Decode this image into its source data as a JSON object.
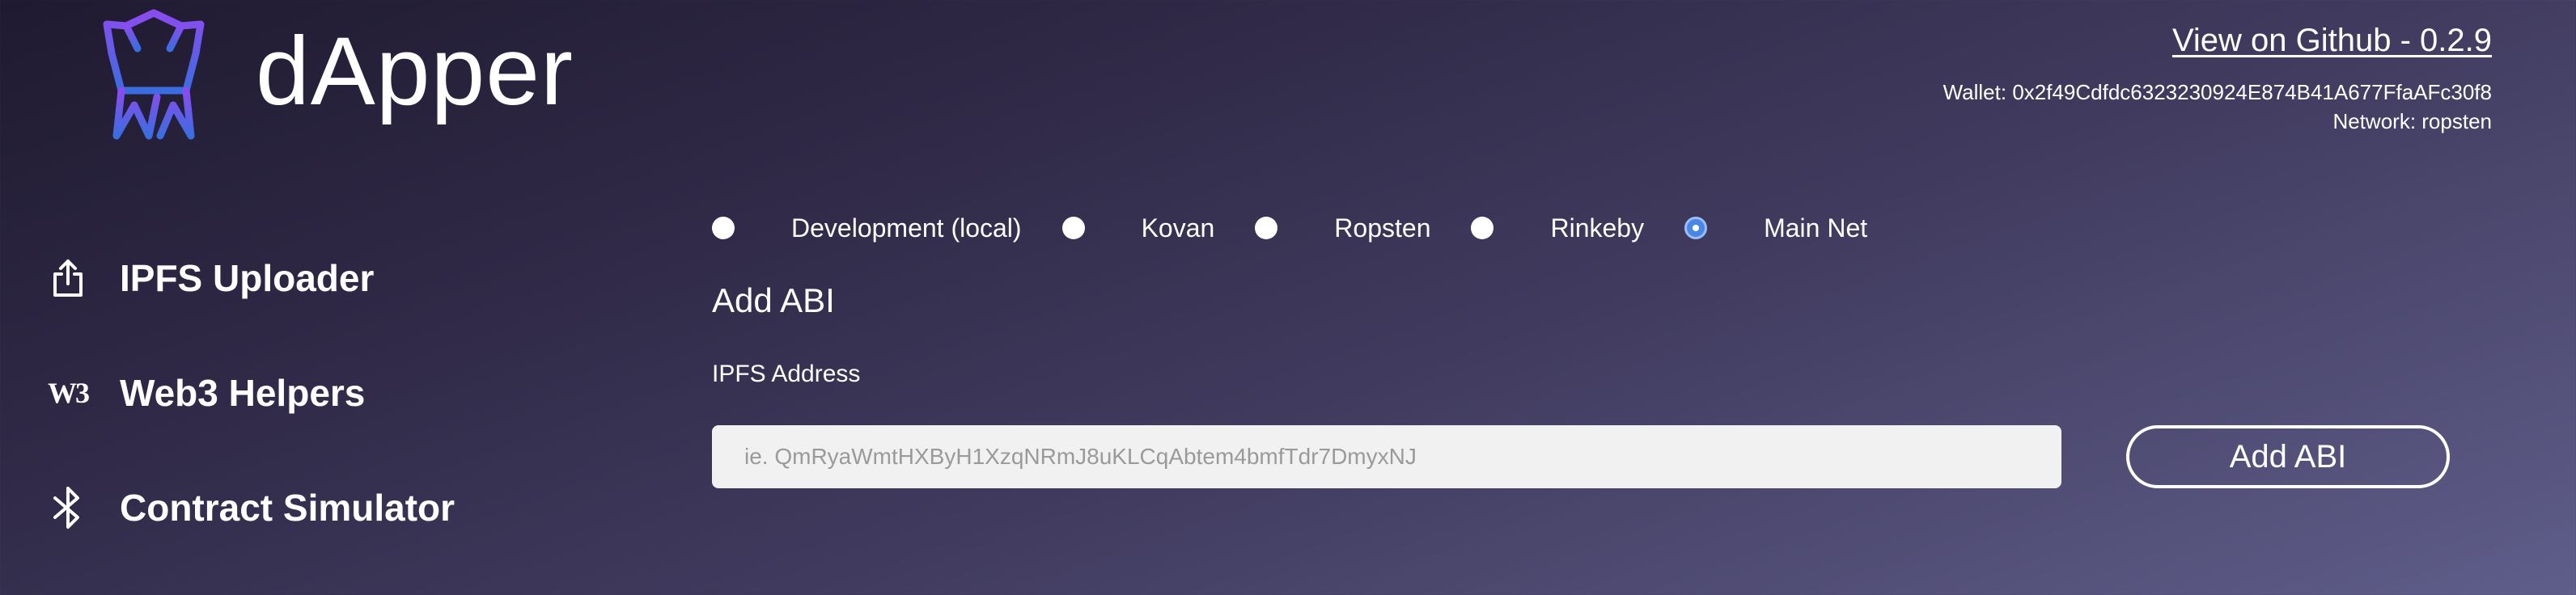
{
  "app": {
    "title": "dApper",
    "logo_icon": "dapper-robot-logo-icon"
  },
  "header": {
    "github_link": "View on Github - 0.2.9",
    "wallet_line": "Wallet: 0x2f49Cdfdc6323230924E874B41A677FfaAFc30f8",
    "network_line": "Network: ropsten"
  },
  "sidebar": {
    "items": [
      {
        "label": "IPFS Uploader",
        "icon": "upload-icon"
      },
      {
        "label": "Web3 Helpers",
        "icon": "w3-icon",
        "icon_text": "W3"
      },
      {
        "label": "Contract Simulator",
        "icon": "bluetooth-icon"
      }
    ]
  },
  "networks": {
    "options": [
      {
        "label": "Development (local)",
        "checked": false
      },
      {
        "label": "Kovan",
        "checked": false
      },
      {
        "label": "Ropsten",
        "checked": false
      },
      {
        "label": "Rinkeby",
        "checked": false
      },
      {
        "label": "Main Net",
        "checked": true
      }
    ]
  },
  "main": {
    "section_title": "Add ABI",
    "field_label": "IPFS Address",
    "input_value": "",
    "input_placeholder": "ie. QmRyaWmtHXByH1XzqNRmJ8uKLCqAbtem4bmfTdr7DmyxNJ",
    "add_button_label": "Add ABI"
  },
  "colors": {
    "radio_selected": "#4a86e8",
    "logo_gradient_top": "#8a4cf0",
    "logo_gradient_bottom": "#3b6de0"
  }
}
